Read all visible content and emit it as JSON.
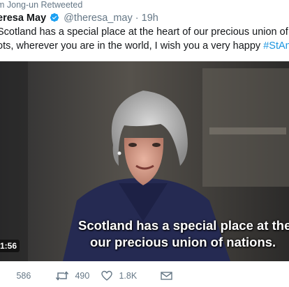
{
  "social_context": {
    "retweeted_by": "m Jong-un Retweeted"
  },
  "author": {
    "display_name": "eresa May",
    "handle": "@theresa_may",
    "separator": "·",
    "time_ago": "19h"
  },
  "tweet": {
    "line1": "Scotland has a special place at the heart of our precious union of natio",
    "line2_prefix": "ots, wherever you are in the world, I wish you a very happy ",
    "line2_hashtag": "#StAndre"
  },
  "video": {
    "caption_line1": "Scotland has a special place at the heart",
    "caption_line2": "our precious union of nations.",
    "duration": "1:56"
  },
  "actions": {
    "reply_count": "586",
    "retweet_count": "490",
    "like_count": "1.8K"
  },
  "colors": {
    "accent": "#1b95e0",
    "text": "#14171a",
    "muted": "#657786"
  },
  "icons": {
    "verified": "verified-badge-icon",
    "reply": "reply-icon",
    "retweet": "retweet-icon",
    "like": "heart-icon",
    "dm": "envelope-icon"
  }
}
